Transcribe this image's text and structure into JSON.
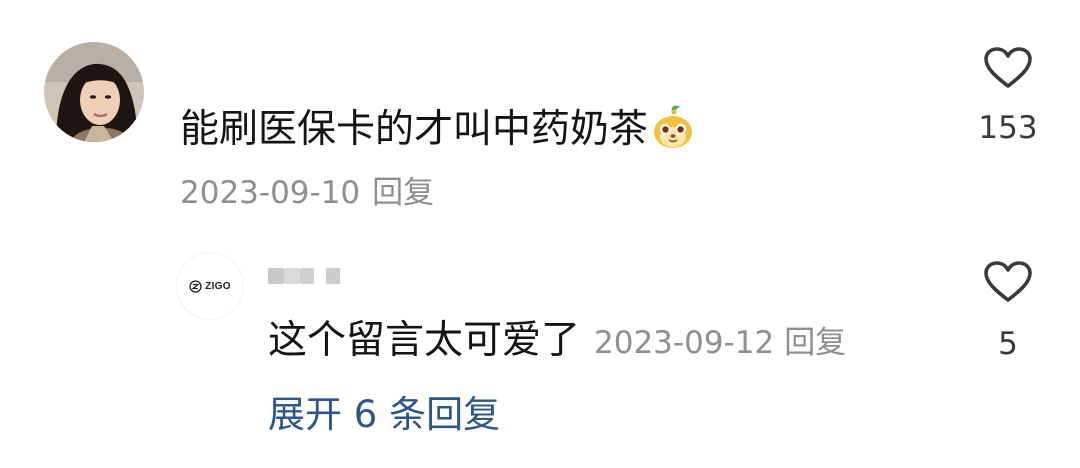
{
  "comment": {
    "text": "能刷医保卡的才叫中药奶茶",
    "emoji": "monkey-face-emoji",
    "date": "2023-09-10",
    "reply_label": "回复",
    "likes": "153"
  },
  "reply": {
    "avatar_logo": "ZIGO",
    "text": "这个留言太可爱了",
    "date": "2023-09-12",
    "reply_label": "回复",
    "likes": "5"
  },
  "expand_label": "展开 6 条回复",
  "colors": {
    "text": "#141414",
    "meta": "#8f8f8f",
    "link": "#2f5688",
    "icon": "#3a3a3a"
  }
}
